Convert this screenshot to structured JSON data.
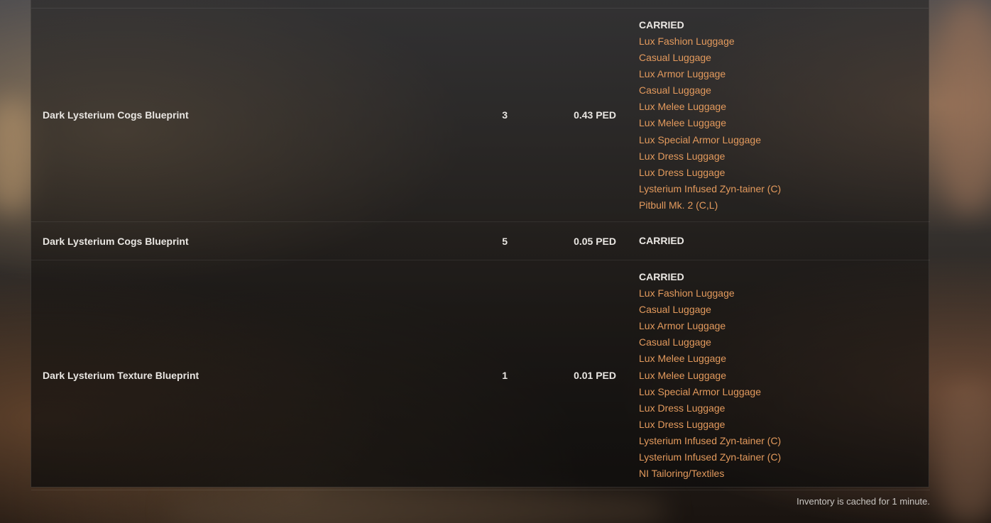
{
  "colors": {
    "text": "#e9e6e2",
    "link": "#e39a5d",
    "footer": "#c9c6c2"
  },
  "rows": [
    {
      "name": "Dark Lysterium Cogs Blueprint",
      "quantity": "3",
      "value": "0.43 PED",
      "container": "CARRIED",
      "items": [
        "Lux Fashion Luggage",
        "Casual Luggage",
        "Lux Armor Luggage",
        "Casual Luggage",
        "Lux Melee Luggage",
        "Lux Melee Luggage",
        "Lux Special Armor Luggage",
        "Lux Dress Luggage",
        "Lux Dress Luggage",
        "Lysterium Infused Zyn-tainer (C)",
        "Pitbull Mk. 2 (C,L)"
      ]
    },
    {
      "name": "Dark Lysterium Cogs Blueprint",
      "quantity": "5",
      "value": "0.05 PED",
      "container": "CARRIED",
      "items": []
    },
    {
      "name": "Dark Lysterium Texture Blueprint",
      "quantity": "1",
      "value": "0.01 PED",
      "container": "CARRIED",
      "items": [
        "Lux Fashion Luggage",
        "Casual Luggage",
        "Lux Armor Luggage",
        "Casual Luggage",
        "Lux Melee Luggage",
        "Lux Melee Luggage",
        "Lux Special Armor Luggage",
        "Lux Dress Luggage",
        "Lux Dress Luggage",
        "Lysterium Infused Zyn-tainer (C)",
        "Lysterium Infused Zyn-tainer (C)",
        "NI Tailoring/Textiles"
      ]
    }
  ],
  "footer": {
    "note": "Inventory is cached for 1 minute."
  }
}
